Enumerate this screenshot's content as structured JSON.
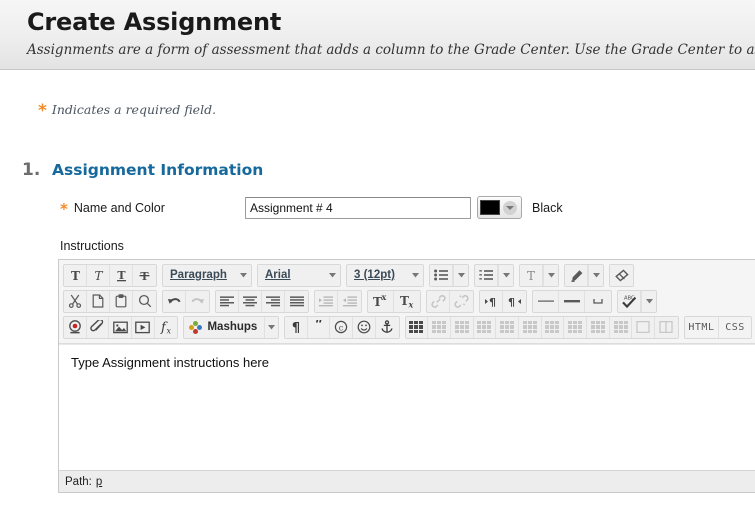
{
  "header": {
    "title": "Create Assignment",
    "subtitle": "Assignments are a form of assessment that adds a column to the Grade Center. Use the Grade Center to assign grades"
  },
  "required_note": {
    "asterisk": "*",
    "text": "Indicates a required field."
  },
  "section": {
    "number": "1.",
    "title": "Assignment Information"
  },
  "name_and_color": {
    "asterisk": "*",
    "label": "Name and Color",
    "input_value": "Assignment # 4",
    "input_placeholder": "",
    "color_value": "#000000",
    "color_name": "Black"
  },
  "instructions": {
    "label": "Instructions",
    "content": "Type Assignment instructions here",
    "path_label": "Path:",
    "path_value": "p"
  },
  "toolbar": {
    "row1": {
      "bold_title": "Bold",
      "italic_title": "Italic",
      "underline_title": "Underline",
      "strikethrough_title": "Strikethrough",
      "paragraph_label": "Paragraph",
      "font_label": "Arial",
      "size_label": "3 (12pt)",
      "bullet_list_title": "Unordered List",
      "number_list_title": "Ordered List",
      "text_color_title": "Text Color",
      "highlight_title": "Highlight Color",
      "eraser_title": "Remove Formatting"
    },
    "row2": {
      "cut_title": "Cut",
      "copy_title": "Copy",
      "paste_title": "Paste",
      "find_title": "Find",
      "undo_title": "Undo",
      "redo_title": "Redo",
      "align_left_title": "Align Left",
      "align_center_title": "Align Center",
      "align_right_title": "Align Right",
      "align_justify_title": "Justify",
      "indent_title": "Indent",
      "outdent_title": "Outdent",
      "superscript_title": "Superscript",
      "subscript_title": "Subscript",
      "link_title": "Insert Link",
      "unlink_title": "Remove Link",
      "ltr_title": "Left to Right",
      "rtl_title": "Right to Left",
      "hr_title": "Horizontal Rule",
      "line_title": "Line",
      "nbsp_title": "Non-breaking Space",
      "spellcheck_title": "Spell Check"
    },
    "row3": {
      "record_title": "Record from Webcam",
      "attach_title": "Attach File",
      "image_title": "Insert Image",
      "video_title": "Insert Media",
      "formula_title": "Insert Math Formula",
      "mashups_label": "Mashups",
      "pilcrow_title": "Show Blocks",
      "quote_title": "Block Quote",
      "copyright_title": "Insert Symbol",
      "emoticon_title": "Insert Emoticon",
      "anchor_title": "Insert Anchor",
      "table_title": "Insert Table",
      "table_props_title": "Table Properties",
      "table_row_props_title": "Table Row Properties",
      "table_insert_row_before_title": "Insert Row Before",
      "table_insert_row_after_title": "Insert Row After",
      "table_delete_row_title": "Delete Row",
      "table_insert_col_before_title": "Insert Column Before",
      "table_insert_col_after_title": "Insert Column After",
      "table_delete_col_title": "Delete Column",
      "table_split_title": "Split Cells",
      "table_merge_title": "Merge Cells",
      "html_label": "HTML",
      "css_label": "CSS"
    }
  },
  "colors": {
    "accent_orange": "#f28b29",
    "section_blue": "#15699c",
    "header_gradient_top": "#f6f6f6",
    "header_gradient_bottom": "#e3e3e3",
    "toolbar_bg": "#f0f0f0",
    "record_red": "#cc2222"
  }
}
